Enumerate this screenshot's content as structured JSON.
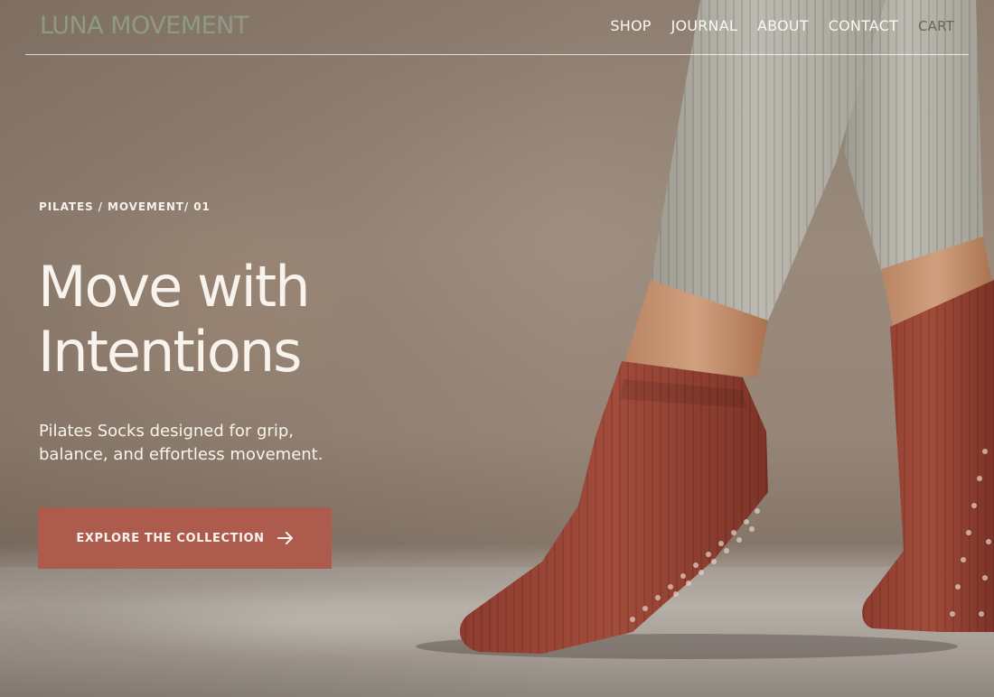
{
  "brand": {
    "logo_text": "LUNA MOVEMENT",
    "logo_color": "#8e9a84"
  },
  "nav": {
    "items": [
      {
        "label": "SHOP"
      },
      {
        "label": "JOURNAL"
      },
      {
        "label": "ABOUT"
      },
      {
        "label": "CONTACT"
      }
    ],
    "cart_label": "CART"
  },
  "hero": {
    "eyebrow": "PILATES / MOVEMENT/ 01",
    "headline_lines": [
      "Move with",
      "Intentions"
    ],
    "subtext_lines": [
      "Pilates Socks designed for grip,",
      "balance, and effortless movement."
    ],
    "cta_label": "EXPLORE THE COLLECTION",
    "cta_icon": "arrow-right-icon",
    "cta_color": "#ac5b4c",
    "image_subject": "hero-photo-legs-in-ribbed-leggings-and-terracotta-grip-socks"
  }
}
